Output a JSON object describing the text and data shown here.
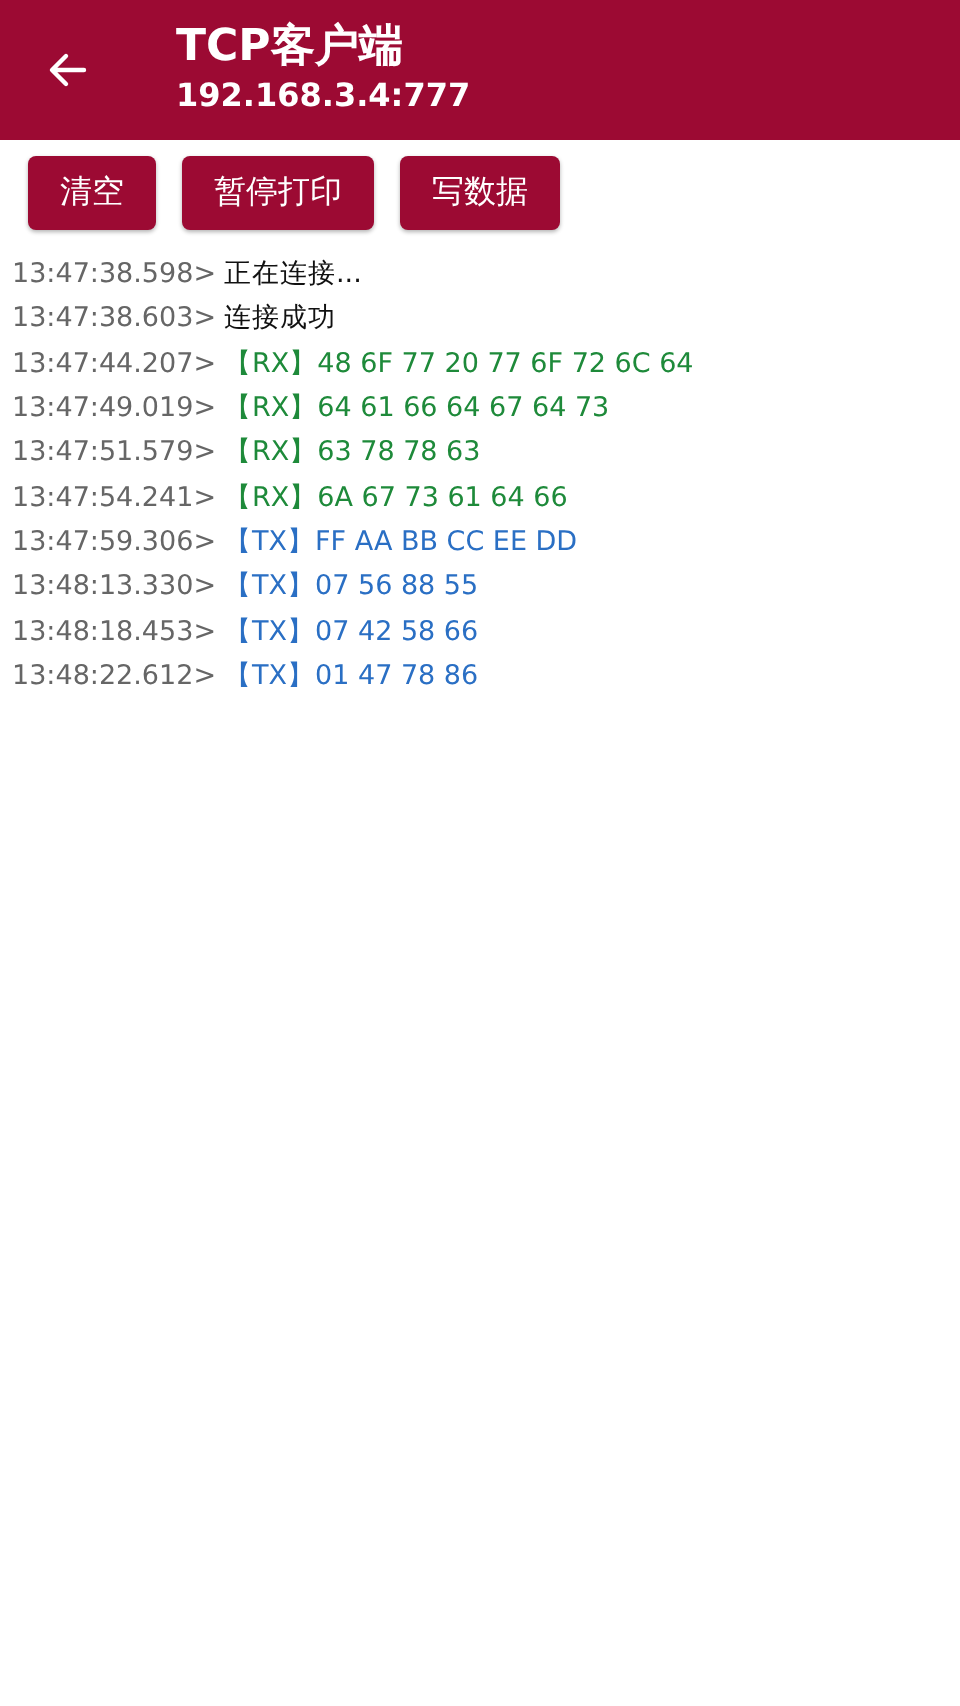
{
  "app_bar": {
    "title": "TCP客户端",
    "subtitle": "192.168.3.4:777"
  },
  "buttons": [
    "清空",
    "暂停打印",
    "写数据"
  ],
  "log": [
    {
      "time": "13:47:38.598>",
      "text": "正在连接...",
      "kind": "info"
    },
    {
      "time": "13:47:38.603>",
      "text": "连接成功",
      "kind": "info"
    },
    {
      "time": "13:47:44.207>",
      "text": "【RX】48 6F 77 20 77 6F 72 6C 64",
      "kind": "rx"
    },
    {
      "time": "13:47:49.019>",
      "text": "【RX】64 61 66 64 67 64 73",
      "kind": "rx"
    },
    {
      "time": "13:47:51.579>",
      "text": "【RX】63 78 78 63",
      "kind": "rx"
    },
    {
      "time": "13:47:54.241>",
      "text": "【RX】6A 67 73 61 64 66",
      "kind": "rx"
    },
    {
      "time": "13:47:59.306>",
      "text": "【TX】FF AA BB CC EE DD",
      "kind": "tx"
    },
    {
      "time": "13:48:13.330>",
      "text": "【TX】07 56 88 55",
      "kind": "tx"
    },
    {
      "time": "13:48:18.453>",
      "text": "【TX】07 42 58 66",
      "kind": "tx"
    },
    {
      "time": "13:48:22.612>",
      "text": "【TX】01 47 78 86",
      "kind": "tx"
    }
  ]
}
